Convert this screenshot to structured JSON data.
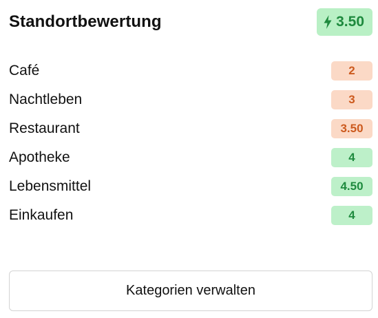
{
  "header": {
    "title": "Standortbewertung",
    "overall_score": "3.50",
    "score_icon": "lightning-bolt-icon"
  },
  "categories": [
    {
      "label": "Café",
      "score": "2",
      "status": "warn"
    },
    {
      "label": "Nachtleben",
      "score": "3",
      "status": "warn"
    },
    {
      "label": "Restaurant",
      "score": "3.50",
      "status": "warn"
    },
    {
      "label": "Apotheke",
      "score": "4",
      "status": "good"
    },
    {
      "label": "Lebensmittel",
      "score": "4.50",
      "status": "good"
    },
    {
      "label": "Einkaufen",
      "score": "4",
      "status": "good"
    }
  ],
  "actions": {
    "manage_label": "Kategorien verwalten"
  },
  "colors": {
    "good_bg": "#b9f0c5",
    "good_text": "#1e8a3e",
    "warn_bg": "#fbd9c6",
    "warn_text": "#cc5a1e"
  }
}
